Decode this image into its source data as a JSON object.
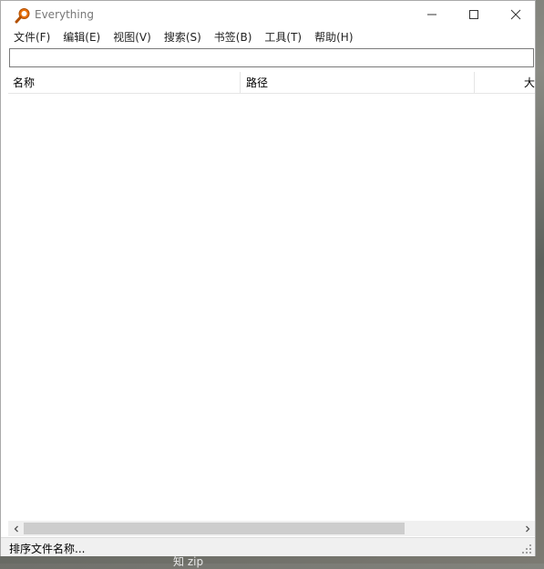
{
  "window": {
    "title": "Everything"
  },
  "menu": {
    "items": [
      "文件(F)",
      "编辑(E)",
      "视图(V)",
      "搜索(S)",
      "书签(B)",
      "工具(T)",
      "帮助(H)"
    ]
  },
  "search": {
    "value": ""
  },
  "columns": {
    "name": "名称",
    "path": "路径",
    "size": "大"
  },
  "status": {
    "text": "排序文件名称..."
  },
  "background": {
    "text": "知 zip"
  },
  "colors": {
    "app_icon": "#e8700a",
    "window_bg": "#ffffff",
    "chrome_bg": "#f0f0f0",
    "scroll_thumb": "#cdcdcd"
  }
}
